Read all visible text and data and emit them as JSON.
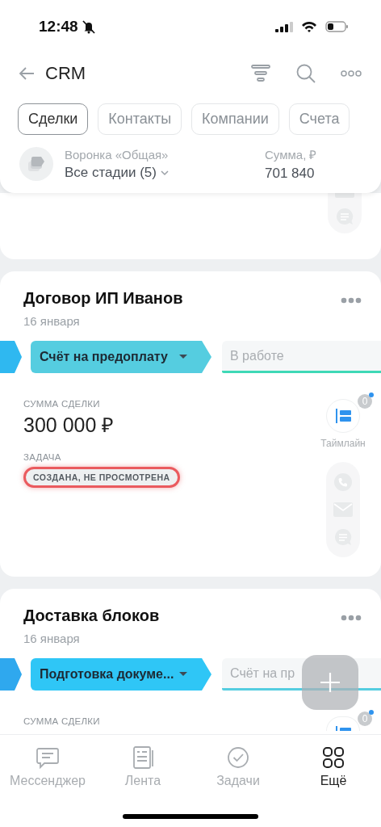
{
  "status_bar": {
    "time": "12:48",
    "silent": true
  },
  "header": {
    "title": "CRM"
  },
  "tabs": [
    {
      "label": "Сделки",
      "selected": true
    },
    {
      "label": "Контакты",
      "selected": false
    },
    {
      "label": "Компании",
      "selected": false
    },
    {
      "label": "Счета",
      "selected": false
    }
  ],
  "summary": {
    "funnel_label": "Воронка «Общая»",
    "stages": "Все стадии (5)",
    "sum_label": "Сумма, ₽",
    "sum": "701 840"
  },
  "deals": [
    {
      "title": "Договор ИП Иванов",
      "date": "16 января",
      "previous_stage": {
        "color": "#2fb8f0"
      },
      "current_stage": {
        "label": "Счёт на предоплату",
        "color": "#55cde0"
      },
      "next_stage": {
        "label": "В работе",
        "color": "#3fd9b6"
      },
      "amount_label": "СУММА СДЕЛКИ",
      "amount": "300 000 ₽",
      "task_label": "ЗАДАЧА",
      "task_status": "СОЗДАНА, НЕ ПРОСМОТРЕНА",
      "timeline": {
        "label": "Таймлайн",
        "count": "0",
        "unread": true
      }
    },
    {
      "title": "Доставка блоков",
      "date": "16 января",
      "previous_stage": {
        "color": "#2fa8ee"
      },
      "current_stage": {
        "label": "Подготовка докуме...",
        "color": "#2fc6f6"
      },
      "next_stage": {
        "label": "Счёт на пр",
        "color": "#55cde0"
      },
      "amount_label": "СУММА СДЕЛКИ",
      "timeline": {
        "count": "0",
        "unread": true
      }
    }
  ],
  "nav": [
    {
      "label": "Мессенджер",
      "selected": false
    },
    {
      "label": "Лента",
      "selected": false
    },
    {
      "label": "Задачи",
      "selected": false
    },
    {
      "label": "Ещё",
      "selected": true
    }
  ]
}
